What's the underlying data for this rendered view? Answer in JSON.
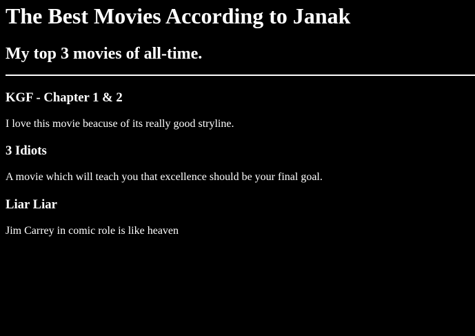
{
  "page": {
    "title": "The Best Movies According to Janak",
    "subtitle": "My top 3 movies of all-time."
  },
  "movies": [
    {
      "title": "KGF - Chapter 1 & 2",
      "description": "I love this movie beacuse of its really good stryline."
    },
    {
      "title": "3 Idiots",
      "description": "A movie which will teach you that excellence should be your final goal."
    },
    {
      "title": "Liar Liar",
      "description": "Jim Carrey in comic role is like heaven"
    }
  ],
  "colors": {
    "background": "#000000",
    "text": "#ffffff"
  }
}
